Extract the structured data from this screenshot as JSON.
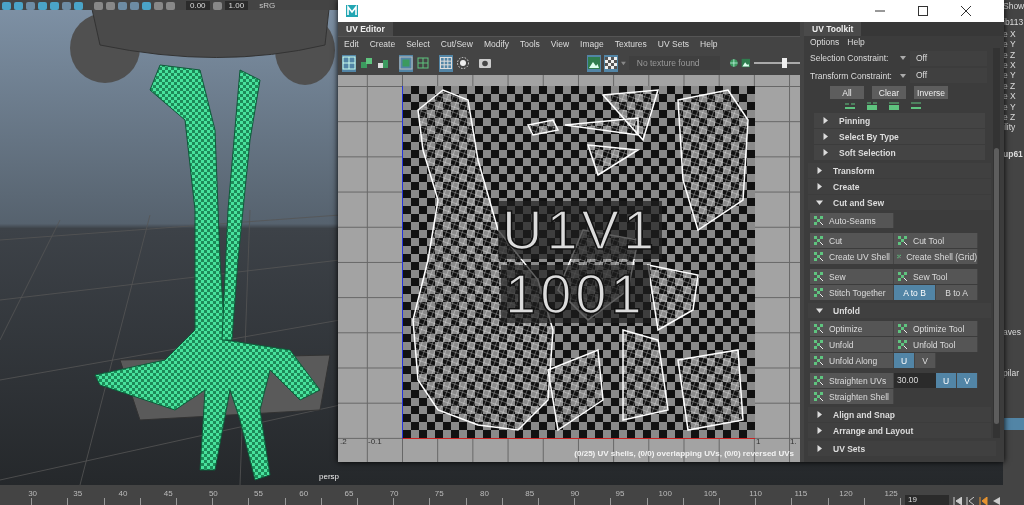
{
  "shelf": {
    "fields": [
      "0.00",
      "1.00"
    ],
    "color_space": "sRG"
  },
  "viewport": {
    "camera": "persp"
  },
  "attribute_editor": {
    "header": "Show",
    "node": "ib113",
    "channels": [
      "e X",
      "e Y",
      "e Z",
      "e X",
      "e Y",
      "e Z",
      "e X",
      "e Y",
      "e Z",
      "ility"
    ],
    "shape": "up61",
    "items": [
      "aves",
      "pilar"
    ]
  },
  "timeline": {
    "ticks": [
      "30",
      "35",
      "40",
      "45",
      "50",
      "55",
      "60",
      "65",
      "70",
      "75",
      "80",
      "85",
      "90",
      "95",
      "100",
      "105",
      "110",
      "115",
      "120",
      "125"
    ],
    "current_frame": "19"
  },
  "uv_editor": {
    "tab": "UV Editor",
    "menu": [
      "Edit",
      "Create",
      "Select",
      "Cut/Sew",
      "Modify",
      "Tools",
      "View",
      "Image",
      "Textures",
      "UV Sets",
      "Help"
    ],
    "toolbar": [
      {
        "kind": "layout",
        "selected": true
      },
      {
        "kind": "shell",
        "selected": false
      },
      {
        "kind": "shell-small",
        "selected": false
      },
      {
        "kind": "frame",
        "selected": true
      },
      {
        "kind": "frame-grid",
        "selected": false
      },
      {
        "kind": "grid",
        "selected": true
      },
      {
        "kind": "dots",
        "selected": false
      },
      {
        "kind": "camera",
        "selected": false
      }
    ],
    "display_toggles": [
      {
        "kind": "image",
        "selected": true
      },
      {
        "kind": "checker",
        "selected": true
      }
    ],
    "texture_menu": {
      "value": "No texture found"
    },
    "exposure": {
      "level": 0.65
    },
    "canvas": {
      "tile_labels": [
        "U1V1",
        "1001"
      ],
      "axis_labels": [
        ".2",
        "-0.1",
        "1",
        "1."
      ]
    },
    "status": "(0/25) UV shells, (0/0) overlapping UVs, (0/0) reversed UVs"
  },
  "uv_toolkit": {
    "tab": "UV Toolkit",
    "menu": [
      "Options",
      "Help"
    ],
    "constraints": [
      {
        "label": "Selection Constraint:",
        "value": "Off"
      },
      {
        "label": "Transform Constraint:",
        "value": "Off"
      }
    ],
    "select_buttons": [
      "All",
      "Clear",
      "Inverse"
    ],
    "subsections": [
      {
        "title": "Pinning",
        "expanded": false
      },
      {
        "title": "Select By Type",
        "expanded": false
      },
      {
        "title": "Soft Selection",
        "expanded": false
      }
    ],
    "sections": [
      {
        "title": "Transform",
        "expanded": false
      },
      {
        "title": "Create",
        "expanded": false
      },
      {
        "title": "Cut and Sew",
        "expanded": true,
        "groups": [
          [
            [
              {
                "kind": "tool",
                "label": "Auto-Seams"
              }
            ]
          ],
          [
            [
              {
                "kind": "tool",
                "label": "Cut"
              },
              {
                "kind": "tool",
                "label": "Cut Tool"
              }
            ],
            [
              {
                "kind": "tool",
                "label": "Create UV Shell"
              },
              {
                "kind": "tool",
                "label": "Create Shell (Grid)"
              }
            ]
          ],
          [
            [
              {
                "kind": "tool",
                "label": "Sew"
              },
              {
                "kind": "tool",
                "label": "Sew Tool"
              }
            ],
            [
              {
                "kind": "tool",
                "label": "Stitch Together"
              },
              {
                "kind": "option",
                "label": "A to B",
                "selected": true
              },
              {
                "kind": "option",
                "label": "B to A",
                "selected": false
              }
            ]
          ]
        ]
      },
      {
        "title": "Unfold",
        "expanded": true,
        "groups": [
          [
            [
              {
                "kind": "tool",
                "label": "Optimize"
              },
              {
                "kind": "tool",
                "label": "Optimize Tool"
              }
            ],
            [
              {
                "kind": "tool",
                "label": "Unfold"
              },
              {
                "kind": "tool",
                "label": "Unfold Tool"
              }
            ],
            [
              {
                "kind": "tool",
                "label": "Unfold Along"
              },
              {
                "kind": "option",
                "label": "U",
                "selected": true
              },
              {
                "kind": "option",
                "label": "V",
                "selected": false
              }
            ]
          ],
          [
            [
              {
                "kind": "tool",
                "label": "Straighten UVs"
              },
              {
                "kind": "field",
                "value": "30.00"
              },
              {
                "kind": "option",
                "label": "U",
                "selected": true
              },
              {
                "kind": "option",
                "label": "V",
                "selected": true
              }
            ],
            [
              {
                "kind": "tool",
                "label": "Straighten Shell"
              }
            ]
          ]
        ]
      },
      {
        "title": "Align and Snap",
        "expanded": false
      },
      {
        "title": "Arrange and Layout",
        "expanded": false
      }
    ],
    "footer_section": {
      "title": "UV Sets",
      "expanded": false
    }
  }
}
